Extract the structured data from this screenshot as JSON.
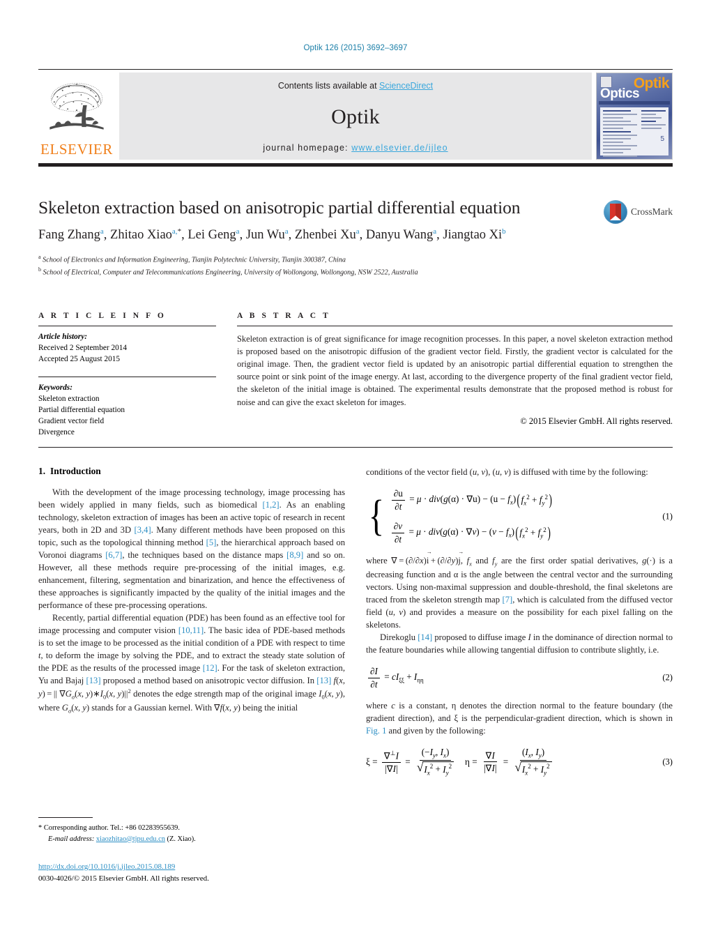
{
  "running_head": "Optik 126 (2015) 3692–3697",
  "masthead": {
    "contents_prefix": "Contents lists available at ",
    "contents_link": "ScienceDirect",
    "journal_name": "Optik",
    "homepage_prefix": "journal homepage:",
    "homepage_url": "www.elsevier.de/ijleo",
    "publisher_wordmark": "ELSEVIER",
    "cover_title_top": "Optik",
    "cover_title_bottom": "Optics",
    "cover_issue": "5"
  },
  "title": "Skeleton extraction based on anisotropic partial differential equation",
  "crossmark_label": "CrossMark",
  "authors_html": "Fang Zhang<sup>a</sup>, Zhitao Xiao<sup>a,</sup><sup class=\"star\">*</sup>, Lei Geng<sup>a</sup>, Jun Wu<sup>a</sup>, Zhenbei Xu<sup>a</sup>, Danyu Wang<sup>a</sup>, Jiangtao Xi<sup>b</sup>",
  "affiliations": [
    {
      "marker": "a",
      "text": "School of Electronics and Information Engineering, Tianjin Polytechnic University, Tianjin 300387, China"
    },
    {
      "marker": "b",
      "text": "School of Electrical, Computer and Telecommunications Engineering, University of Wollongong, Wollongong, NSW 2522, Australia"
    }
  ],
  "article_info": {
    "heading": "A R T I C L E  I N F O",
    "history_label": "Article history:",
    "history": [
      "Received 2 September 2014",
      "Accepted 25 August 2015"
    ],
    "keywords_label": "Keywords:",
    "keywords": [
      "Skeleton extraction",
      "Partial differential equation",
      "Gradient vector field",
      "Divergence"
    ]
  },
  "abstract": {
    "heading": "A B S T R A C T",
    "text": "Skeleton extraction is of great significance for image recognition processes. In this paper, a novel skeleton extraction method is proposed based on the anisotropic diffusion of the gradient vector field. Firstly, the gradient vector is calculated for the original image. Then, the gradient vector field is updated by an anisotropic partial differential equation to strengthen the source point or sink point of the image energy. At last, according to the divergence property of the final gradient vector field, the skeleton of the initial image is obtained. The experimental results demonstrate that the proposed method is robust for noise and can give the exact skeleton for images.",
    "copyright": "© 2015 Elsevier GmbH. All rights reserved."
  },
  "sections": {
    "intro_number": "1.",
    "intro_title": "Introduction"
  },
  "left_column": {
    "p1_html": "With the development of the image processing technology, image processing has been widely applied in many fields, such as biomedical <span class=\"ref\">[1,2]</span>. As an enabling technology, skeleton extraction of images has been an active topic of research in recent years, both in 2D and 3D <span class=\"ref\">[3,4]</span>. Many different methods have been proposed on this topic, such as the topological thinning method <span class=\"ref\">[5]</span>, the hierarchical approach based on Voronoi diagrams <span class=\"ref\">[6,7]</span>, the techniques based on the distance maps <span class=\"ref\">[8,9]</span> and so on. However, all these methods require pre-processing of the initial images, e.g. enhancement, filtering, segmentation and binarization, and hence the effectiveness of these approaches is significantly impacted by the quality of the initial images and the performance of these pre-processing operations.",
    "p2_html": "Recently, partial differential equation (PDE) has been found as an effective tool for image processing and computer vision <span class=\"ref\">[10,11]</span>. The basic idea of PDE-based methods is to set the image to be processed as the initial condition of a PDE with respect to time <i>t</i>, to deform the image by solving the PDE, and to extract the steady state solution of the PDE as the results of the processed image <span class=\"ref\">[12]</span>. For the task of skeleton extraction, Yu and Bajaj <span class=\"ref\">[13]</span> proposed a method based on anisotropic vector diffusion. In <span class=\"ref\">[13]</span> <i>f</i>(<i>x</i>, <i>y</i>)&#8201;=&#8201;|| ∇<i>G<sub>σ</sub></i>(<i>x</i>, <i>y</i>)∗<i>I</i><sub>0</sub>(<i>x</i>, <i>y</i>)||<sup>2</sup> denotes the edge strength map of the original image <i>I</i><sub>0</sub>(<i>x</i>, <i>y</i>), where <i>G<sub>σ</sub></i>(<i>x</i>, <i>y</i>) stands for a Gaussian kernel. With ∇<i>f</i>(<i>x</i>, <i>y</i>) being the initial"
  },
  "right_column": {
    "p1_html": "conditions of the vector field (<i>u</i>, <i>v</i>), (<i>u</i>, <i>v</i>) is diffused with time by the following:",
    "p2_html": "where ∇&#8201;=&#8201;(∂/∂<i>x</i>)<span class=\"vec\">i</span>&#8201;+&#8201;(∂/∂<i>y</i>)<span class=\"vec\">j</span>, <i>f<sub>x</sub></i> and <i>f<sub>y</sub></i> are the first order spatial derivatives, <i>g</i>(·) is a decreasing function and α is the angle between the central vector and the surrounding vectors. Using non-maximal suppression and double-threshold, the final skeletons are traced from the skeleton strength map <span class=\"ref\">[7]</span>, which is calculated from the diffused vector field (<i>u</i>, <i>v</i>) and provides a measure on the possibility for each pixel falling on the skeletons.",
    "p3_html": "Direkoglu <span class=\"ref\">[14]</span> proposed to diffuse image <i>I</i> in the dominance of direction normal to the feature boundaries while allowing tangential diffusion to contribute slightly, i.e.",
    "p4_html": "where <i>c</i> is a constant, η denotes the direction normal to the feature boundary (the gradient direction), and ξ is the perpendicular-gradient direction, which is shown in <span class=\"ref\">Fig. 1</span> and given by the following:"
  },
  "equations": {
    "eq1_number": "(1)",
    "eq2_number": "(2)",
    "eq3_number": "(3)"
  },
  "footnote": {
    "star": "*",
    "corresponding": "Corresponding author. Tel.: +86 02283955639.",
    "email_label": "E-mail address:",
    "email": "xiaozhitao@tjpu.edu.cn",
    "email_suffix": "(Z. Xiao)."
  },
  "doi": {
    "url": "http://dx.doi.org/10.1016/j.ijleo.2015.08.189",
    "issn_line": "0030-4026/© 2015 Elsevier GmbH. All rights reserved."
  }
}
